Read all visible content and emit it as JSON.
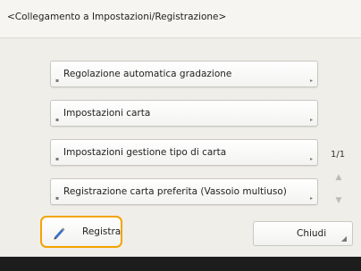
{
  "title": "<Collegamento a Impostazioni/Registrazione>",
  "items": [
    {
      "label": "Regolazione automatica gradazione"
    },
    {
      "label": "Impostazioni carta"
    },
    {
      "label": "Impostazioni gestione tipo di carta"
    },
    {
      "label": "Registrazione carta preferita (Vassoio multiuso)"
    }
  ],
  "pagination": {
    "indicator": "1/1"
  },
  "footer": {
    "registra_label": "Registra",
    "chiudi_label": "Chiudi"
  },
  "colors": {
    "accent": "#f4a300",
    "background": "#efeee9",
    "title_bar": "#f6f5f1"
  },
  "icons": {
    "registra": "pen-icon",
    "scroll_up": "arrow-up-icon",
    "scroll_down": "arrow-down-icon"
  }
}
